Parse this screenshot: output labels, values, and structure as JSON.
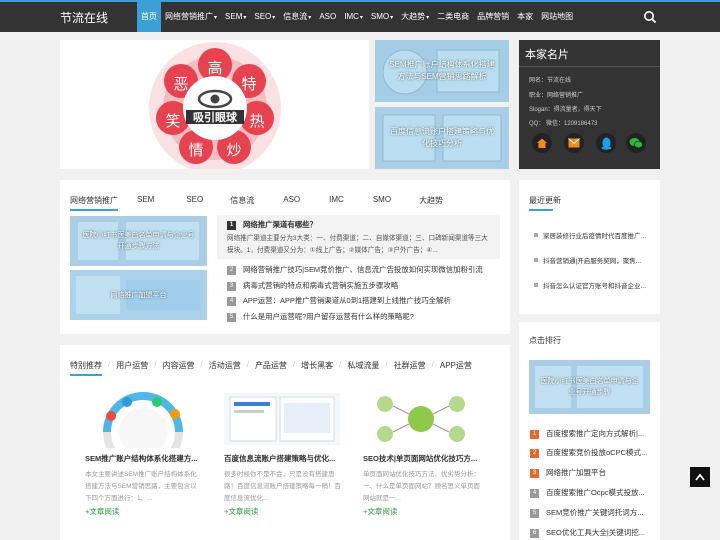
{
  "site": {
    "name": "节流在线"
  },
  "nav": {
    "items": [
      {
        "label": "首页",
        "active": true,
        "dropdown": false
      },
      {
        "label": "网络营销推广",
        "active": false,
        "dropdown": true
      },
      {
        "label": "SEM",
        "active": false,
        "dropdown": true
      },
      {
        "label": "SEO",
        "active": false,
        "dropdown": true
      },
      {
        "label": "信息流",
        "active": false,
        "dropdown": true
      },
      {
        "label": "ASO",
        "active": false,
        "dropdown": false
      },
      {
        "label": "IMC",
        "active": false,
        "dropdown": true
      },
      {
        "label": "SMO",
        "active": false,
        "dropdown": true
      },
      {
        "label": "大趋势",
        "active": false,
        "dropdown": true
      },
      {
        "label": "二类电商",
        "active": false,
        "dropdown": false
      },
      {
        "label": "品牌营销",
        "active": false,
        "dropdown": false
      },
      {
        "label": "本家",
        "active": false,
        "dropdown": false
      },
      {
        "label": "网站地图",
        "active": false,
        "dropdown": false
      }
    ]
  },
  "slider": {
    "petals": [
      "高",
      "特",
      "热",
      "炒",
      "情",
      "笑",
      "恶"
    ],
    "center_text": "吸引眼球"
  },
  "thumbs": [
    {
      "caption": "SEM推广账户结构体系化搭建方法与SEM营销思路解析"
    },
    {
      "caption": "百度信息流账户搭建策略与优化技巧分析"
    }
  ],
  "profile": {
    "title": "本家名片",
    "lines": [
      "网名：节流在线",
      "职业：网络营销推广",
      "Slogan：得流量者，得天下",
      "QQ：   微信：1209186473"
    ]
  },
  "category": {
    "tabs": [
      "网络营销推广",
      "SEM",
      "SEO",
      "信息流",
      "ASO",
      "IMC",
      "SMO",
      "大趋势"
    ],
    "features": [
      {
        "caption": "医院小红书医美白名单申请与企业号开通步骤方法"
      },
      {
        "caption": "网络推广加盟平台"
      }
    ],
    "hot_title": "网络推广渠道有哪些？",
    "hot_summary": "网络推广渠道主要分为3大类：一、付费渠道；二、自媒体渠道；三、口碑新闻渠道等三大模块。1，付费渠道又分为：①线上广告；②媒体广告；③户外广告；④...",
    "list": [
      {
        "n": "2",
        "title": "网络营销推广技巧|SEM竞价推广、信息流广告投放如何实现微信加粉引流"
      },
      {
        "n": "3",
        "title": "病毒式营销的特点和病毒式营销实施五步骤攻略"
      },
      {
        "n": "4",
        "title": "APP运营：APP推广营销渠道从0到1搭建到上线推广技巧全解析"
      },
      {
        "n": "5",
        "title": "什么是用户运营呢?用户留存运营有什么样的策略呢?"
      }
    ]
  },
  "special": {
    "tabs": [
      "特别推荐",
      "用户运营",
      "内容运营",
      "活动运营",
      "产品运营",
      "增长黑客",
      "私域流量",
      "社群运营",
      "APP运营"
    ],
    "cards": [
      {
        "title": "SEM推广账户结构体系化搭建方...",
        "text": "本文主要讲述SEM推广账户结构体系化搭建方法与SEM营销思路，主要包含以下四个方面进行：1、...",
        "link": "+文章阅读"
      },
      {
        "title": "百度信息流账户搭建策略与优化...",
        "text": "很多时候你不是不会，只是没有搭建思路！百度信息流账户搭建策略每一稍！百度信息流优化...",
        "link": "+文章阅读"
      },
      {
        "title": "SEO技术|单页面网站优化技巧方...",
        "text": "单页面网站优化技巧方法、优劣势分析：一、什么是单页面网站？顾名思义单页面网站就是一...",
        "link": "+文章阅读"
      }
    ]
  },
  "recent": {
    "title": "最近更新",
    "items": [
      "家居装修行业后疫情时代百度推广...",
      "抖音营销通|开启服务契网，聚焦...",
      "抖音怎么认证官方账号和抖音企业..."
    ]
  },
  "ranking": {
    "title": "点击排行",
    "banner_caption": "医院小红书医美白名单申请与企业号开通步骤",
    "items": [
      {
        "n": "1",
        "title": "百度搜索推广定向方式解析|..."
      },
      {
        "n": "2",
        "title": "百度搜索竞价投放oCPC模式..."
      },
      {
        "n": "3",
        "title": "网络推广加盟平台"
      },
      {
        "n": "4",
        "title": "百度搜索推广Ocpc模式投放..."
      },
      {
        "n": "5",
        "title": "SEM竞价推广关键词托词方..."
      },
      {
        "n": "6",
        "title": "SEO优化工具大全|关键词挖..."
      }
    ]
  },
  "colors": {
    "accent": "#3c9fd8",
    "topbar": "#333333",
    "rank_hot": "#e36a2b",
    "link_green": "#2e9b3e"
  }
}
